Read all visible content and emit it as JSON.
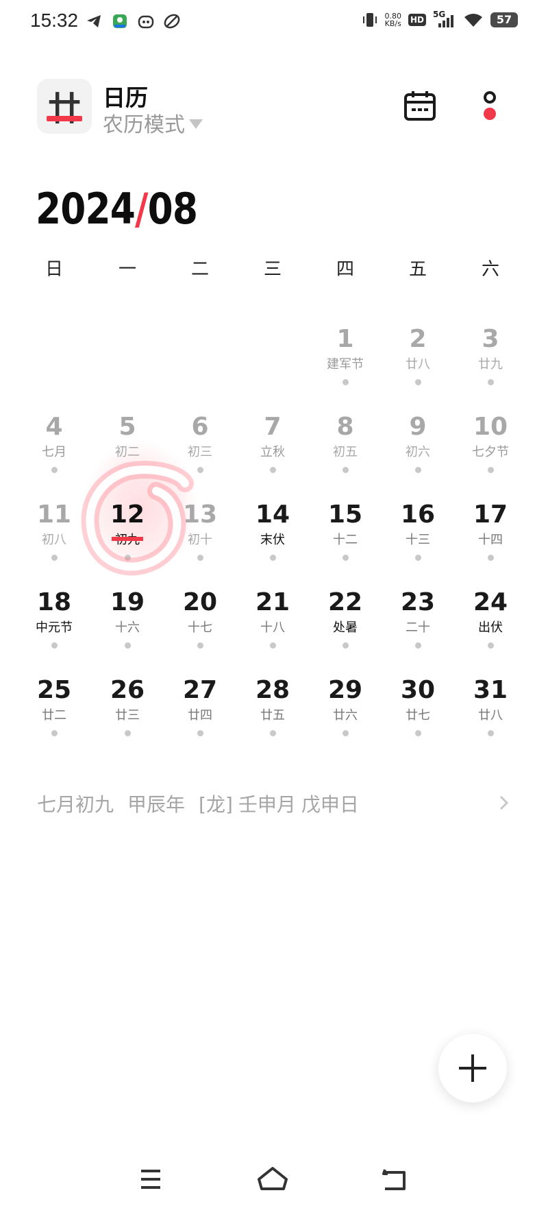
{
  "status_bar": {
    "time": "15:32",
    "net_speed_value": "0.80",
    "net_speed_unit": "KB/s",
    "hd": "HD",
    "network": "5G",
    "battery": "57"
  },
  "header": {
    "app_icon_glyph": "廿",
    "title": "日历",
    "mode": "农历模式"
  },
  "month_title": {
    "year": "2024",
    "separator": "/",
    "month": "08"
  },
  "weekdays": [
    "日",
    "一",
    "二",
    "三",
    "四",
    "五",
    "六"
  ],
  "days": [
    {
      "n": "1",
      "l": "建军节"
    },
    {
      "n": "2",
      "l": "廿八"
    },
    {
      "n": "3",
      "l": "廿九"
    },
    {
      "n": "4",
      "l": "七月"
    },
    {
      "n": "5",
      "l": "初二"
    },
    {
      "n": "6",
      "l": "初三"
    },
    {
      "n": "7",
      "l": "立秋"
    },
    {
      "n": "8",
      "l": "初五"
    },
    {
      "n": "9",
      "l": "初六"
    },
    {
      "n": "10",
      "l": "七夕节"
    },
    {
      "n": "11",
      "l": "初八"
    },
    {
      "n": "12",
      "l": "初九"
    },
    {
      "n": "13",
      "l": "初十"
    },
    {
      "n": "14",
      "l": "末伏"
    },
    {
      "n": "15",
      "l": "十二"
    },
    {
      "n": "16",
      "l": "十三"
    },
    {
      "n": "17",
      "l": "十四"
    },
    {
      "n": "18",
      "l": "中元节"
    },
    {
      "n": "19",
      "l": "十六"
    },
    {
      "n": "20",
      "l": "十七"
    },
    {
      "n": "21",
      "l": "十八"
    },
    {
      "n": "22",
      "l": "处暑"
    },
    {
      "n": "23",
      "l": "二十"
    },
    {
      "n": "24",
      "l": "出伏"
    },
    {
      "n": "25",
      "l": "廿二"
    },
    {
      "n": "26",
      "l": "廿三"
    },
    {
      "n": "27",
      "l": "廿四"
    },
    {
      "n": "28",
      "l": "廿五"
    },
    {
      "n": "29",
      "l": "廿六"
    },
    {
      "n": "30",
      "l": "廿七"
    },
    {
      "n": "31",
      "l": "廿八"
    }
  ],
  "lunar_summary": {
    "lunar_date": "七月初九",
    "year": "甲辰年",
    "zodiac": "[龙]",
    "month": "壬申月",
    "day": "戊申日"
  },
  "colors": {
    "accent": "#f2394a",
    "muted": "#a8a8a8"
  }
}
